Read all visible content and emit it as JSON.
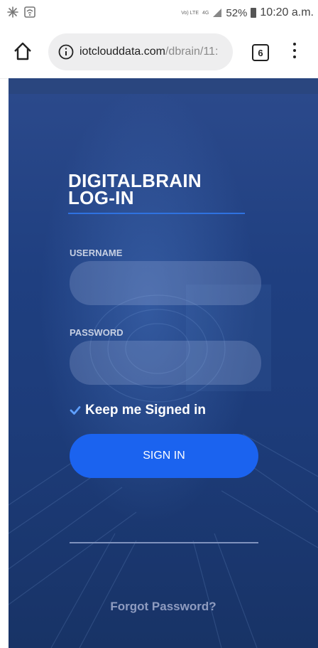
{
  "status_bar": {
    "left_icons": [
      "snowflake-icon",
      "wifi-icon"
    ],
    "volte_label": "Vo) LTE",
    "network_label": "4G",
    "battery_percent": "52%",
    "time": "10:20 a.m."
  },
  "browser": {
    "url_host": "iotclouddata.com",
    "url_path": "/dbrain/11:",
    "tab_count": "6"
  },
  "login": {
    "title": "DIGITALBRAIN LOG-IN",
    "username_label": "USERNAME",
    "username_value": "",
    "password_label": "PASSWORD",
    "password_value": "",
    "remember_label": "Keep me Signed in",
    "remember_checked": true,
    "sign_in_label": "SIGN IN",
    "forgot_label": "Forgot Password?"
  },
  "colors": {
    "accent_button": "#1b63ef",
    "background": "#1f3f80",
    "underline": "#2f72e0"
  }
}
